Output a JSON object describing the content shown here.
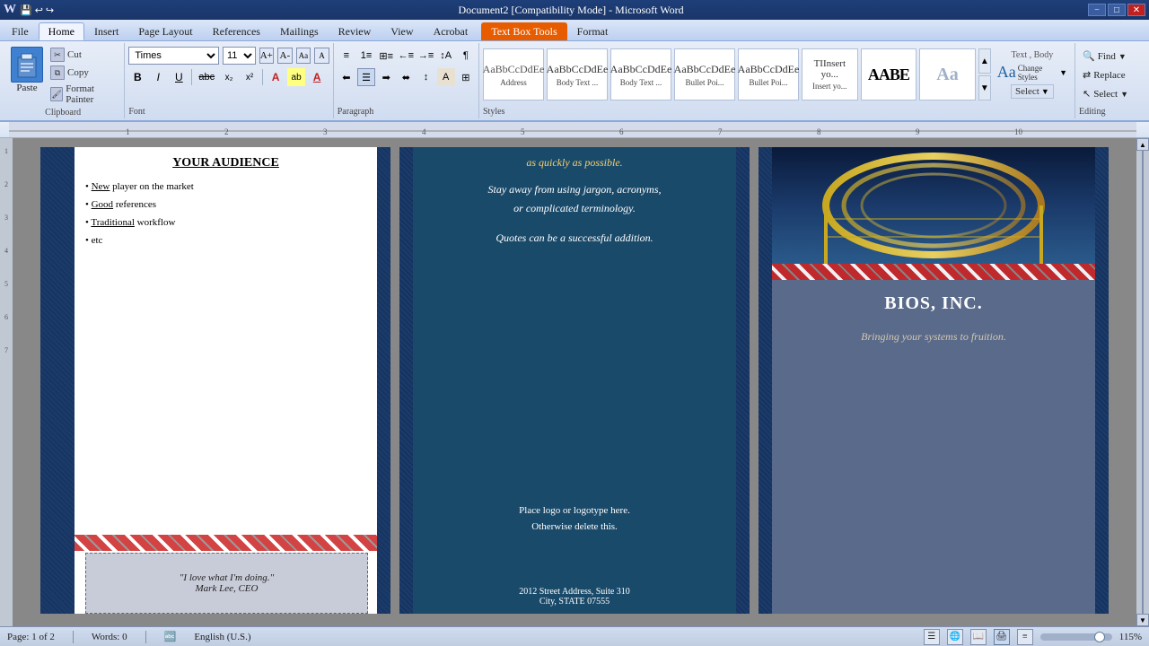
{
  "titlebar": {
    "title": "Document2 [Compatibility Mode] - Microsoft Word",
    "minimize": "−",
    "maximize": "□",
    "close": "✕"
  },
  "tabs": [
    {
      "label": "File",
      "active": false
    },
    {
      "label": "Home",
      "active": true
    },
    {
      "label": "Insert",
      "active": false
    },
    {
      "label": "Page Layout",
      "active": false
    },
    {
      "label": "References",
      "active": false
    },
    {
      "label": "Mailings",
      "active": false
    },
    {
      "label": "Review",
      "active": false
    },
    {
      "label": "View",
      "active": false
    },
    {
      "label": "Acrobat",
      "active": false
    },
    {
      "label": "Format",
      "active": false
    },
    {
      "label": "Text Box Tools",
      "active": false,
      "special": true
    }
  ],
  "ribbon": {
    "clipboard": {
      "label": "Clipboard",
      "paste_label": "Paste",
      "cut_label": "Cut",
      "copy_label": "Copy",
      "format_painter_label": "Format Painter"
    },
    "font": {
      "label": "Font",
      "font_name": "Times",
      "font_size": "11",
      "bold": "B",
      "italic": "I",
      "underline": "U",
      "strikethrough": "abc",
      "subscript": "x₂",
      "superscript": "x²"
    },
    "paragraph": {
      "label": "Paragraph"
    },
    "styles": {
      "label": "Styles",
      "items": [
        {
          "label": "AaBbCcDdEe",
          "sublabel": "Address"
        },
        {
          "label": "AaBbCcDdEe",
          "sublabel": "Body Text ..."
        },
        {
          "label": "AaBbCcDdEe",
          "sublabel": "Body Text ..."
        },
        {
          "label": "AaBbCcDdEe",
          "sublabel": "Bullet Poi..."
        },
        {
          "label": "AaBbCcDdEe",
          "sublabel": "Bullet Poi..."
        },
        {
          "label": "ΤΙInsert yo...",
          "sublabel": "Insert yo..."
        },
        {
          "label": "AABE",
          "sublabel": "",
          "big": true
        },
        {
          "label": "Aa",
          "sublabel": ""
        }
      ],
      "change_styles": "Change Styles",
      "select": "Select",
      "text_body": "Text , Body"
    },
    "editing": {
      "label": "Editing",
      "find": "Find",
      "replace": "Replace",
      "select": "Select"
    }
  },
  "page1": {
    "title": "YOUR AUDIENCE",
    "items": [
      "New player on the market",
      "Good references",
      "Traditional workflow",
      "etc"
    ],
    "quote": "\"I love what I'm doing.\"",
    "quote_author": "Mark Lee, CEO"
  },
  "page2": {
    "intro": "as quickly as possible.",
    "body1": "Stay away from using jargon, acronyms,",
    "body2": "or complicated terminology.",
    "body3": "Quotes can be a successful addition.",
    "logo_line1": "Place logo  or logotype here.",
    "logo_line2": "Otherwise delete this.",
    "address1": "2012 Street Address,  Suite 310",
    "address2": "City, STATE 07555"
  },
  "page3": {
    "company": "BIOS, INC.",
    "tagline": "Bringing your systems to fruition."
  },
  "statusbar": {
    "page_info": "Page: 1 of 2",
    "words": "Words: 0",
    "language": "English (U.S.)",
    "zoom": "115%"
  }
}
